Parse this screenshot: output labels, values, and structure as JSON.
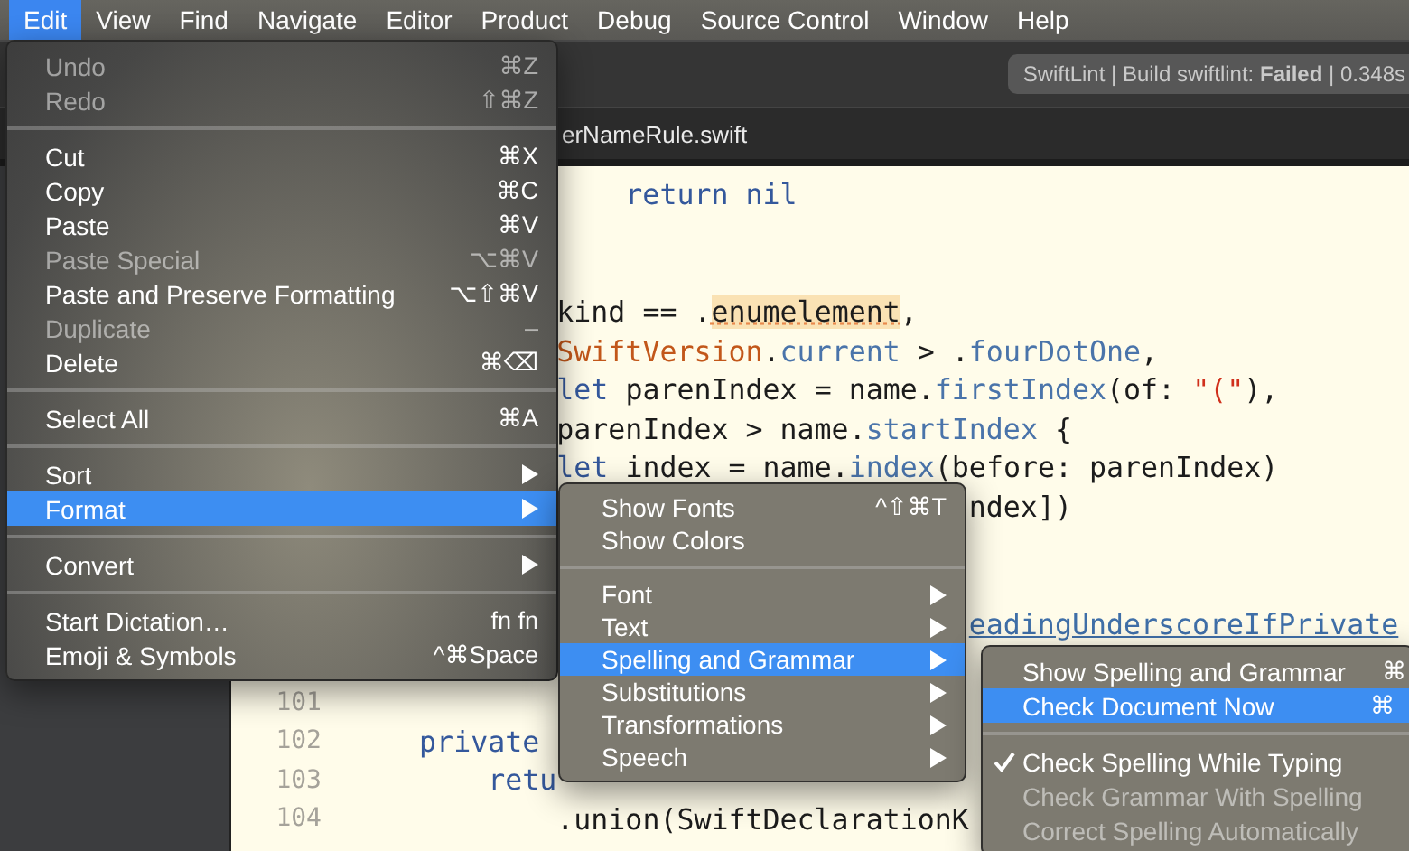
{
  "menu_bar": [
    {
      "label": "Edit",
      "selected": true
    },
    {
      "label": "View",
      "selected": false
    },
    {
      "label": "Find",
      "selected": false
    },
    {
      "label": "Navigate",
      "selected": false
    },
    {
      "label": "Editor",
      "selected": false
    },
    {
      "label": "Product",
      "selected": false
    },
    {
      "label": "Debug",
      "selected": false
    },
    {
      "label": "Source Control",
      "selected": false
    },
    {
      "label": "Window",
      "selected": false
    },
    {
      "label": "Help",
      "selected": false
    }
  ],
  "toolbar": {
    "status": "SwiftLint | Build swiftlint: **Failed** | 0.348s"
  },
  "tab_bar": {
    "file": "erNameRule.swift"
  },
  "editor": {
    "lines": [
      {
        "kind": "code",
        "tokens": [
          {
            "text": "                return nil",
            "kind": "keyword"
          }
        ]
      },
      {
        "kind": "blank"
      },
      {
        "kind": "blank"
      },
      {
        "kind": "code",
        "tokens": [
          {
            "text": "            kind == .",
            "kind": "plain"
          },
          {
            "text": "enumelement",
            "kind": "highlight"
          },
          {
            "text": ",",
            "kind": "plain"
          }
        ]
      },
      {
        "kind": "code",
        "tokens": [
          {
            "text": "            SwiftVersion",
            "kind": "type"
          },
          {
            "text": ".",
            "kind": "plain"
          },
          {
            "text": "current",
            "kind": "member"
          },
          {
            "text": " > .",
            "kind": "plain"
          },
          {
            "text": "fourDotOne",
            "kind": "member"
          },
          {
            "text": ",",
            "kind": "plain"
          }
        ]
      },
      {
        "kind": "code",
        "tokens": [
          {
            "text": "            let",
            "kind": "keyword"
          },
          {
            "text": " parenIndex = name.",
            "kind": "plain"
          },
          {
            "text": "firstIndex",
            "kind": "member"
          },
          {
            "text": "(of: ",
            "kind": "plain"
          },
          {
            "text": "\"(\"",
            "kind": "string"
          },
          {
            "text": "),",
            "kind": "plain"
          }
        ]
      },
      {
        "kind": "code",
        "tokens": [
          {
            "text": "            parenIndex > name.",
            "kind": "plain"
          },
          {
            "text": "startIndex",
            "kind": "member"
          },
          {
            "text": " {",
            "kind": "plain"
          }
        ]
      },
      {
        "kind": "code",
        "tokens": [
          {
            "text": "            let",
            "kind": "keyword"
          },
          {
            "text": " index = name.",
            "kind": "plain"
          },
          {
            "text": "index",
            "kind": "member"
          },
          {
            "text": "(before: parenIndex)",
            "kind": "plain"
          }
        ]
      },
      {
        "kind": "code",
        "tokens": [
          {
            "text": "                                    ndex])",
            "kind": "plain"
          }
        ]
      },
      {
        "kind": "blank"
      },
      {
        "kind": "blank"
      },
      {
        "kind": "code",
        "tokens": [
          {
            "text": "                                    eadingUnderscoreIfPrivate",
            "kind": "link"
          }
        ]
      },
      {
        "kind": "blank"
      },
      {
        "kind": "blank",
        "number": "101"
      },
      {
        "kind": "code",
        "number": "102",
        "tokens": [
          {
            "text": "    private",
            "kind": "keyword"
          }
        ]
      },
      {
        "kind": "code",
        "number": "103",
        "tokens": [
          {
            "text": "        retu",
            "kind": "keyword"
          }
        ]
      },
      {
        "kind": "code",
        "number": "104",
        "tokens": [
          {
            "text": "            .union(SwiftDeclarationK",
            "kind": "plain"
          }
        ]
      }
    ]
  },
  "menus": [
    {
      "items": [
        {
          "kind": "command",
          "label": "Undo",
          "shortcut": "⌘Z",
          "disabled": true,
          "selected": false
        },
        {
          "kind": "command",
          "label": "Redo",
          "shortcut": "⇧⌘Z",
          "disabled": true,
          "selected": false
        },
        {
          "kind": "separator"
        },
        {
          "kind": "command",
          "label": "Cut",
          "shortcut": "⌘X",
          "disabled": false,
          "selected": false
        },
        {
          "kind": "command",
          "label": "Copy",
          "shortcut": "⌘C",
          "disabled": false,
          "selected": false
        },
        {
          "kind": "command",
          "label": "Paste",
          "shortcut": "⌘V",
          "disabled": false,
          "selected": false
        },
        {
          "kind": "command",
          "label": "Paste Special",
          "shortcut": "⌥⌘V",
          "disabled": true,
          "selected": false
        },
        {
          "kind": "command",
          "label": "Paste and Preserve Formatting",
          "shortcut": "⌥⇧⌘V",
          "disabled": false,
          "selected": false
        },
        {
          "kind": "command",
          "label": "Duplicate",
          "shortcut": "–",
          "disabled": true,
          "selected": false
        },
        {
          "kind": "command",
          "label": "Delete",
          "shortcut": "⌘⌫",
          "disabled": false,
          "selected": false
        },
        {
          "kind": "separator"
        },
        {
          "kind": "command",
          "label": "Select All",
          "shortcut": "⌘A",
          "disabled": false,
          "selected": false
        },
        {
          "kind": "separator"
        },
        {
          "kind": "submenu",
          "label": "Sort",
          "disabled": false,
          "selected": false
        },
        {
          "kind": "submenu",
          "label": "Format",
          "disabled": false,
          "selected": true
        },
        {
          "kind": "separator"
        },
        {
          "kind": "submenu",
          "label": "Convert",
          "disabled": false,
          "selected": false
        },
        {
          "kind": "separator"
        },
        {
          "kind": "command",
          "label": "Start Dictation…",
          "shortcut": "fn fn",
          "disabled": false,
          "selected": false
        },
        {
          "kind": "command",
          "label": "Emoji & Symbols",
          "shortcut": "^⌘Space",
          "disabled": false,
          "selected": false
        }
      ]
    },
    {
      "items": [
        {
          "kind": "command",
          "label": "Show Fonts",
          "shortcut": "^⇧⌘T",
          "disabled": false,
          "selected": false
        },
        {
          "kind": "command",
          "label": "Show Colors",
          "disabled": false,
          "selected": false
        },
        {
          "kind": "separator"
        },
        {
          "kind": "submenu",
          "label": "Font",
          "disabled": false,
          "selected": false
        },
        {
          "kind": "submenu",
          "label": "Text",
          "disabled": false,
          "selected": false
        },
        {
          "kind": "submenu",
          "label": "Spelling and Grammar",
          "disabled": false,
          "selected": true
        },
        {
          "kind": "submenu",
          "label": "Substitutions",
          "disabled": false,
          "selected": false
        },
        {
          "kind": "submenu",
          "label": "Transformations",
          "disabled": false,
          "selected": false
        },
        {
          "kind": "submenu",
          "label": "Speech",
          "disabled": false,
          "selected": false
        }
      ]
    },
    {
      "items": [
        {
          "kind": "command",
          "label": "Show Spelling and Grammar",
          "shortcut": "⌘",
          "disabled": false,
          "selected": false,
          "checked": false
        },
        {
          "kind": "command",
          "label": "Check Document Now",
          "shortcut": "⌘",
          "disabled": false,
          "selected": true,
          "checked": false
        },
        {
          "kind": "separator"
        },
        {
          "kind": "command",
          "label": "Check Spelling While Typing",
          "disabled": false,
          "selected": false,
          "checked": true
        },
        {
          "kind": "command",
          "label": "Check Grammar With Spelling",
          "disabled": true,
          "selected": false,
          "checked": false
        },
        {
          "kind": "command",
          "label": "Correct Spelling Automatically",
          "disabled": true,
          "selected": false,
          "checked": false
        }
      ]
    }
  ]
}
